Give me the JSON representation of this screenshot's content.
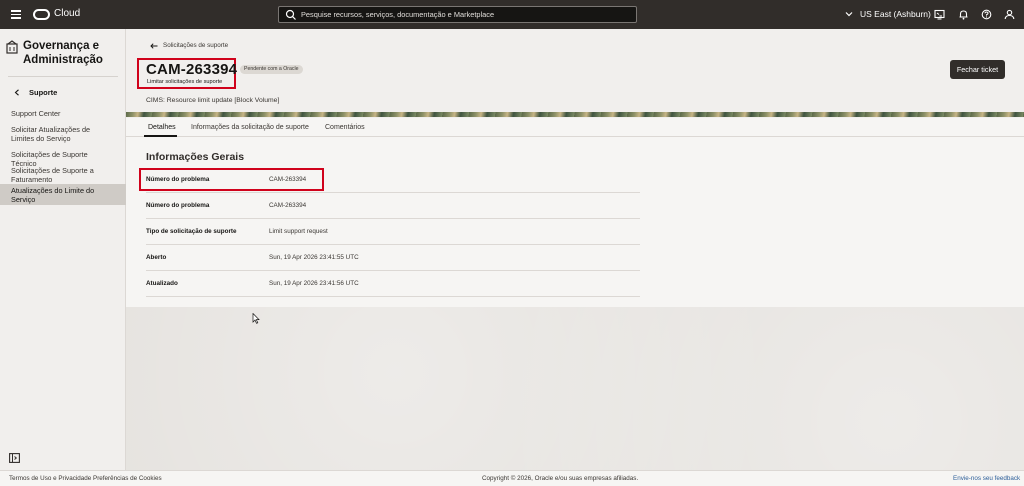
{
  "topbar": {
    "brand": "Cloud",
    "search_placeholder": "Pesquise recursos, serviços, documentação e Marketplace",
    "region": "US East (Ashburn)"
  },
  "sidebar": {
    "title": "Governança e Administração",
    "back_label": "Suporte",
    "items": [
      {
        "label": "Support Center"
      },
      {
        "label": "Solicitar Atualizações de Limites do Serviço"
      },
      {
        "label": "Solicitações de Suporte Técnico"
      },
      {
        "label": "Solicitações de Suporte a Faturamento"
      },
      {
        "label": "Atualizações do Limite do Serviço",
        "active": true
      }
    ]
  },
  "page": {
    "breadcrumb": "Solicitações de suporte",
    "ticket_id": "CAM-263394",
    "ticket_subtitle": "Limitar solicitações de suporte",
    "status_badge": "Pendente com a Oracle",
    "close_button": "Fechar ticket",
    "cims": "CIMS: Resource limit update [Block Volume]",
    "tabs": [
      {
        "label": "Detalhes",
        "active": true
      },
      {
        "label": "Informações da solicitação de suporte"
      },
      {
        "label": "Comentários"
      }
    ],
    "section_title": "Informações Gerais",
    "rows": [
      {
        "label": "Número do problema",
        "value": "CAM-263394"
      },
      {
        "label": "Número do problema",
        "value": "CAM-263394"
      },
      {
        "label": "Tipo de solicitação de suporte",
        "value": "Limit support request"
      },
      {
        "label": "Aberto",
        "value": "Sun, 19 Apr 2026 23:41:55 UTC"
      },
      {
        "label": "Atualizado",
        "value": "Sun, 19 Apr 2026 23:41:56 UTC"
      }
    ]
  },
  "footer": {
    "terms": "Termos de Uso e Privacidade",
    "cookies": "Preferências de Cookies",
    "copyright": "Copyright © 2026, Oracle e/ou suas empresas afiliadas.",
    "feedback": "Envie-nos seu feedback"
  },
  "colors": {
    "topbar_bg": "#312d2a",
    "highlight": "#d0021b",
    "link": "#2d5f9a"
  }
}
